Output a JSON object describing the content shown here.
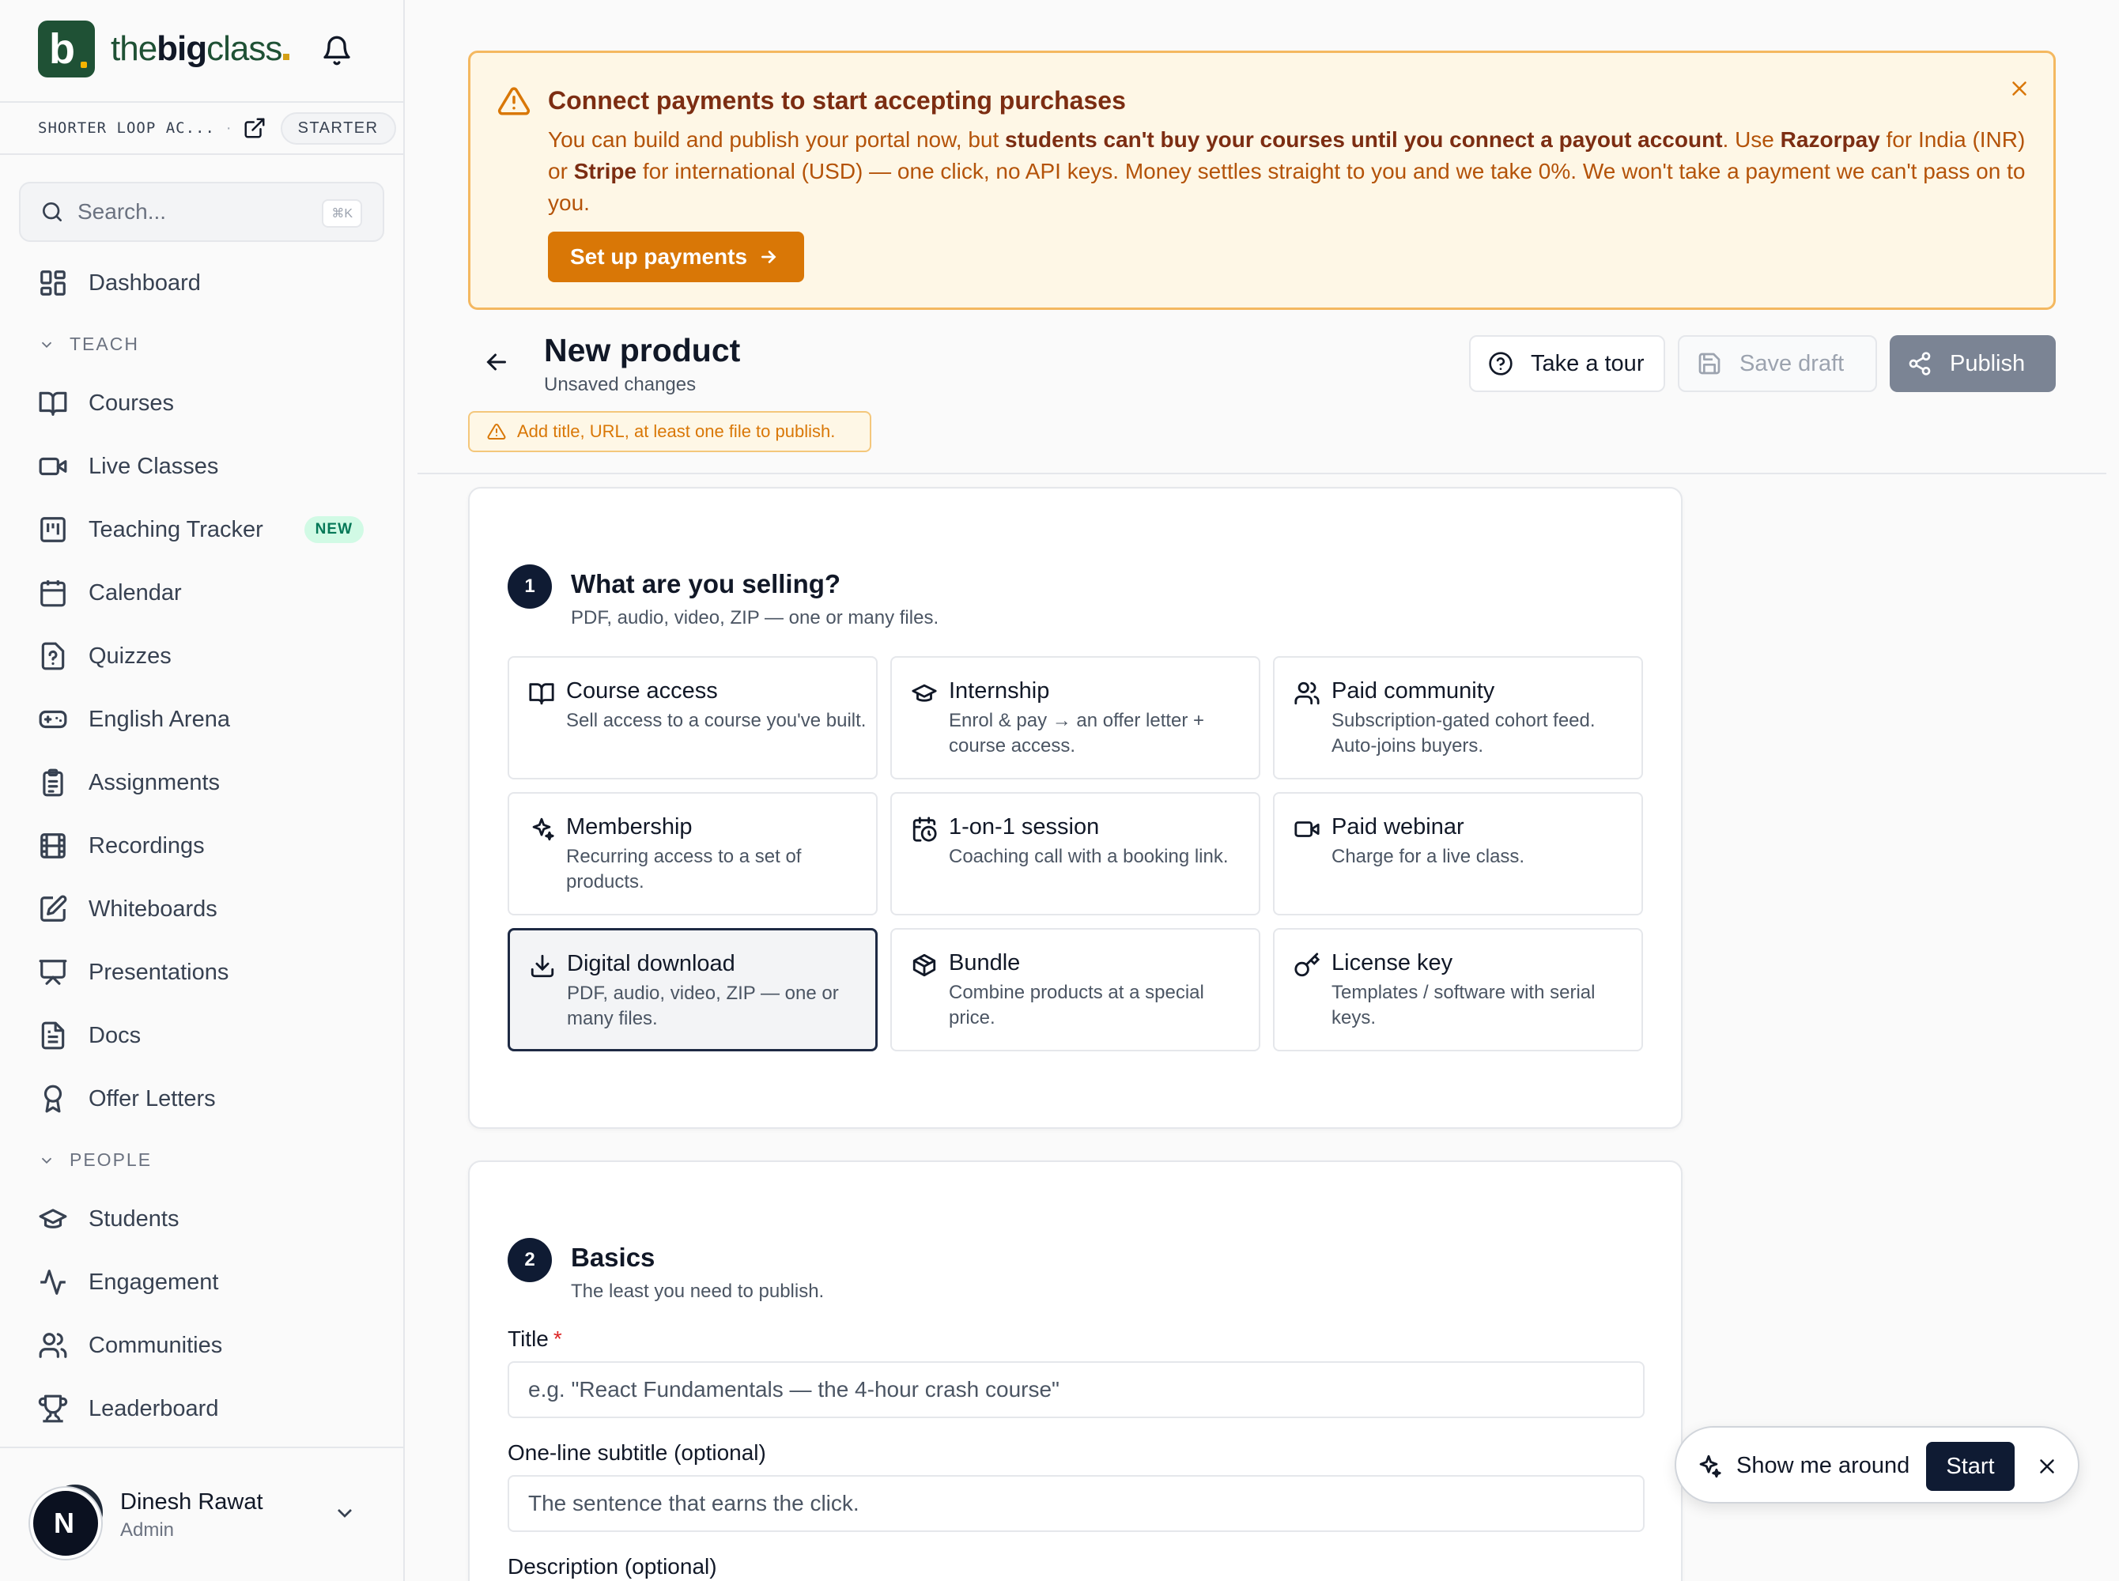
{
  "brand": {
    "prefix": "the",
    "bold": "big",
    "suffix": "class"
  },
  "org": {
    "name": "SHORTER LOOP AC...",
    "separator": "·",
    "plan": "STARTER"
  },
  "search": {
    "placeholder": "Search...",
    "shortcut": "⌘K"
  },
  "nav": {
    "dashboard": "Dashboard",
    "teach_section": "TEACH",
    "courses": "Courses",
    "live_classes": "Live Classes",
    "teaching_tracker": "Teaching Tracker",
    "teaching_tracker_badge": "NEW",
    "calendar": "Calendar",
    "quizzes": "Quizzes",
    "english_arena": "English Arena",
    "assignments": "Assignments",
    "recordings": "Recordings",
    "whiteboards": "Whiteboards",
    "presentations": "Presentations",
    "docs": "Docs",
    "offer_letters": "Offer Letters",
    "people_section": "PEOPLE",
    "students": "Students",
    "engagement": "Engagement",
    "communities": "Communities",
    "leaderboard": "Leaderboard"
  },
  "user": {
    "name": "Dinesh Rawat",
    "role": "Admin",
    "initial": "N"
  },
  "banner": {
    "title": "Connect payments to start accepting purchases",
    "text_1": "You can build and publish your portal now, but ",
    "text_bold_1": "students can't buy your courses until you connect a payout account",
    "text_2": ". Use ",
    "text_bold_2": "Razorpay",
    "text_3": " for India (INR) or ",
    "text_bold_3": "Stripe",
    "text_4": "  for international (USD) — one click, no API keys. Money settles straight to you and we take 0%. We won't take a payment we can't pass on to you.",
    "button": "Set up payments"
  },
  "header": {
    "title": "New product",
    "subtitle": "Unsaved changes",
    "warning": "Add title, URL, at least one file to publish.",
    "tour_button": "Take a tour",
    "draft_button": "Save draft",
    "publish_button": "Publish"
  },
  "step1": {
    "number": "1",
    "title": "What are you selling?",
    "subtitle": "PDF, audio, video, ZIP — one or many files.",
    "options": [
      {
        "title": "Course access",
        "desc": "Sell access to a course you've built.",
        "icon": "book-icon"
      },
      {
        "title": "Internship",
        "desc": "Enrol & pay → an offer letter + course access.",
        "icon": "graduation-cap-icon"
      },
      {
        "title": "Paid community",
        "desc": "Subscription-gated cohort feed. Auto-joins buyers.",
        "icon": "users-icon"
      },
      {
        "title": "Membership",
        "desc": "Recurring access to a set of products.",
        "icon": "sparkles-icon"
      },
      {
        "title": "1-on-1 session",
        "desc": "Coaching call with a booking link.",
        "icon": "calendar-clock-icon"
      },
      {
        "title": "Paid webinar",
        "desc": "Charge for a live class.",
        "icon": "video-icon"
      },
      {
        "title": "Digital download",
        "desc": "PDF, audio, video, ZIP — one or many files.",
        "icon": "download-icon",
        "selected": true
      },
      {
        "title": "Bundle",
        "desc": "Combine products at a special price.",
        "icon": "package-icon"
      },
      {
        "title": "License key",
        "desc": "Templates / software with serial keys.",
        "icon": "key-icon"
      }
    ]
  },
  "step2": {
    "number": "2",
    "title": "Basics",
    "subtitle": "The least you need to publish.",
    "title_label": "Title",
    "required_mark": "*",
    "title_placeholder": "e.g. \"React Fundamentals — the 4-hour crash course\"",
    "subtitle_label": "One-line subtitle (optional)",
    "subtitle_placeholder": "The sentence that earns the click.",
    "description_label": "Description (optional)"
  },
  "tour": {
    "label": "Show me around",
    "start": "Start"
  },
  "colors": {
    "brand_green": "#1f5135",
    "accent_orange": "#d97706",
    "navy": "#0f1b33",
    "publish_gray": "#7b8494"
  }
}
